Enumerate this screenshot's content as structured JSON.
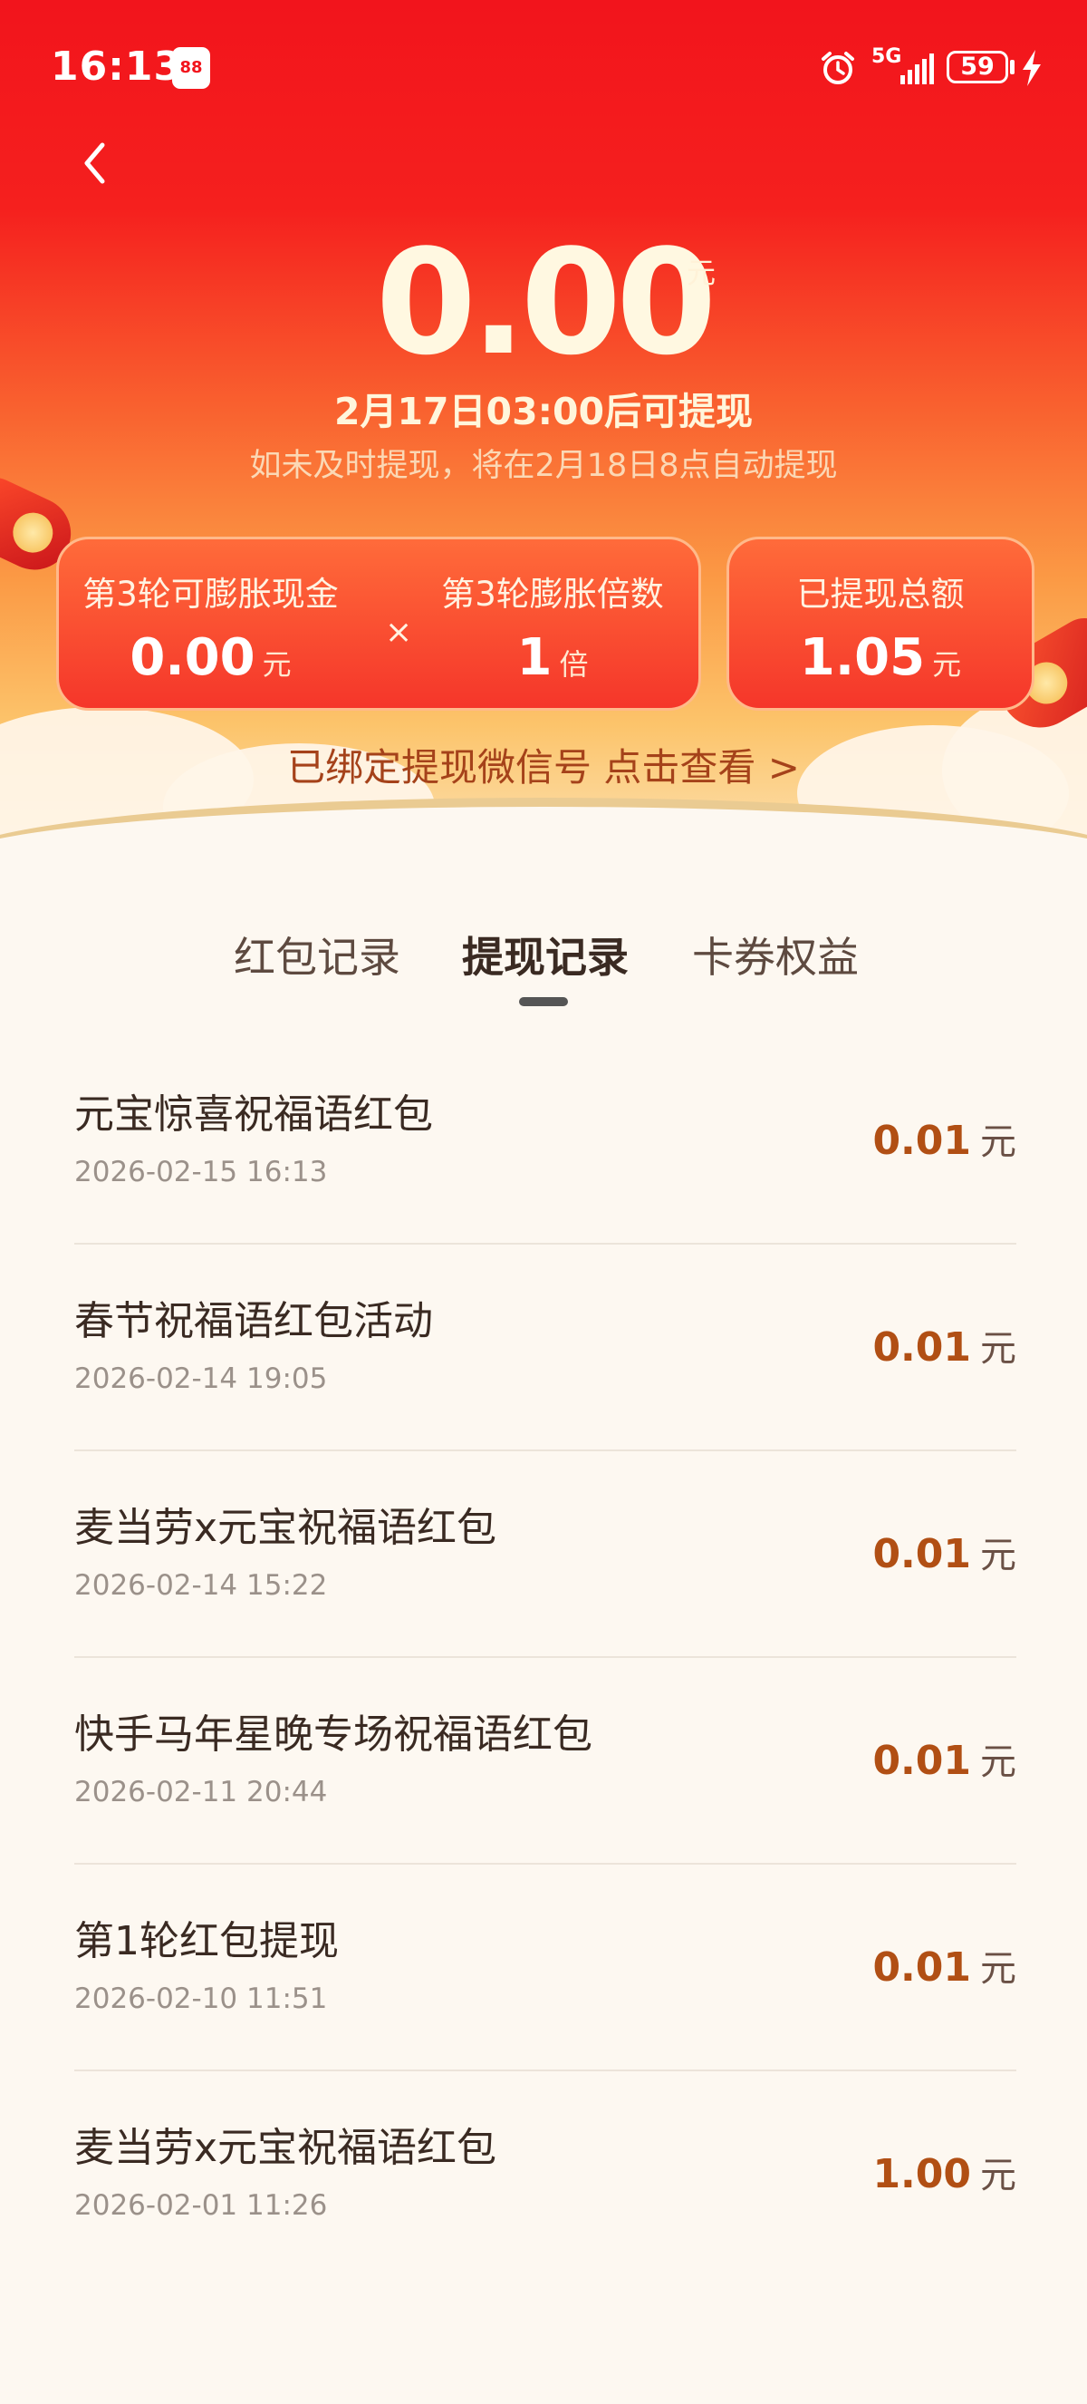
{
  "status": {
    "time": "16:13",
    "app_badge": "88",
    "signal": "5G",
    "battery": "59"
  },
  "header": {
    "balance": "0.00",
    "balance_unit": "元",
    "withdraw_time": "2月17日03:00后可提现",
    "auto_note": "如未及时提现，将在2月18日8点自动提现"
  },
  "stats": {
    "inflatable_label": "第3轮可膨胀现金",
    "inflatable_value": "0.00",
    "inflatable_unit": "元",
    "times_sign": "×",
    "multiplier_label": "第3轮膨胀倍数",
    "multiplier_value": "1",
    "multiplier_unit": "倍",
    "total_label": "已提现总额",
    "total_value": "1.05",
    "total_unit": "元"
  },
  "wechat_link": "已绑定提现微信号 点击查看 >",
  "tabs": [
    {
      "label": "红包记录"
    },
    {
      "label": "提现记录",
      "active": true
    },
    {
      "label": "卡券权益"
    }
  ],
  "records": [
    {
      "title": "元宝惊喜祝福语红包",
      "date": "2026-02-15 16:13",
      "amount": "0.01",
      "unit": "元"
    },
    {
      "title": "春节祝福语红包活动",
      "date": "2026-02-14 19:05",
      "amount": "0.01",
      "unit": "元"
    },
    {
      "title": "麦当劳x元宝祝福语红包",
      "date": "2026-02-14 15:22",
      "amount": "0.01",
      "unit": "元"
    },
    {
      "title": "快手马年星晚专场祝福语红包",
      "date": "2026-02-11 20:44",
      "amount": "0.01",
      "unit": "元"
    },
    {
      "title": "第1轮红包提现",
      "date": "2026-02-10 11:51",
      "amount": "0.01",
      "unit": "元"
    },
    {
      "title": "麦当劳x元宝祝福语红包",
      "date": "2026-02-01 11:26",
      "amount": "1.00",
      "unit": "元"
    }
  ]
}
